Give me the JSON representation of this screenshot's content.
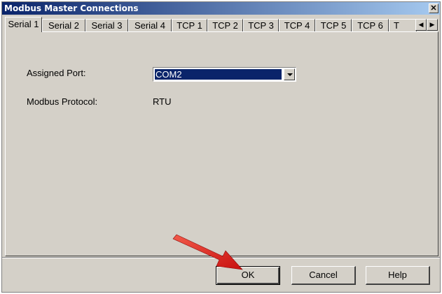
{
  "window": {
    "title": "Modbus Master Connections",
    "close_glyph": "✕"
  },
  "tabs": [
    {
      "label": "Serial 1",
      "active": true
    },
    {
      "label": "Serial 2"
    },
    {
      "label": "Serial 3"
    },
    {
      "label": "Serial 4"
    },
    {
      "label": "TCP 1"
    },
    {
      "label": "TCP 2"
    },
    {
      "label": "TCP 3"
    },
    {
      "label": "TCP 4"
    },
    {
      "label": "TCP 5"
    },
    {
      "label": "TCP 6"
    },
    {
      "label": "T"
    }
  ],
  "tab_scroll": {
    "left_icon": "scroll-left-icon",
    "right_icon": "scroll-right-icon",
    "left_glyph": "◀",
    "right_glyph": "▶"
  },
  "form": {
    "port_label": "Assigned Port:",
    "port_value": "COM2",
    "protocol_label": "Modbus Protocol:",
    "protocol_value": "RTU"
  },
  "buttons": {
    "ok": "OK",
    "cancel": "Cancel",
    "help": "Help"
  },
  "annotation": {
    "icon": "red-pointer-arrow-icon",
    "color": "#e21b1b"
  }
}
